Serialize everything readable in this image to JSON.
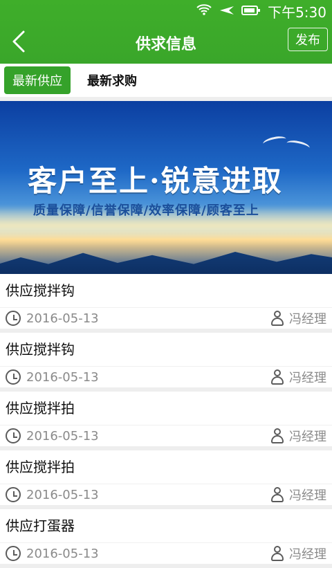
{
  "status": {
    "time": "下午5:30"
  },
  "header": {
    "back_label": "<",
    "title": "供求信息",
    "publish": "发布"
  },
  "tabs": {
    "active": "最新供应",
    "other": "最新求购"
  },
  "banner": {
    "headline": "客户至上·锐意进取",
    "subline": "质量保障/信誉保障/效率保障/顾客至上"
  },
  "items": [
    {
      "title": "供应搅拌钩",
      "date": "2016-05-13",
      "contact": "冯经理"
    },
    {
      "title": "供应搅拌钩",
      "date": "2016-05-13",
      "contact": "冯经理"
    },
    {
      "title": "供应搅拌拍",
      "date": "2016-05-13",
      "contact": "冯经理"
    },
    {
      "title": "供应搅拌拍",
      "date": "2016-05-13",
      "contact": "冯经理"
    },
    {
      "title": "供应打蛋器",
      "date": "2016-05-13",
      "contact": "冯经理"
    }
  ]
}
